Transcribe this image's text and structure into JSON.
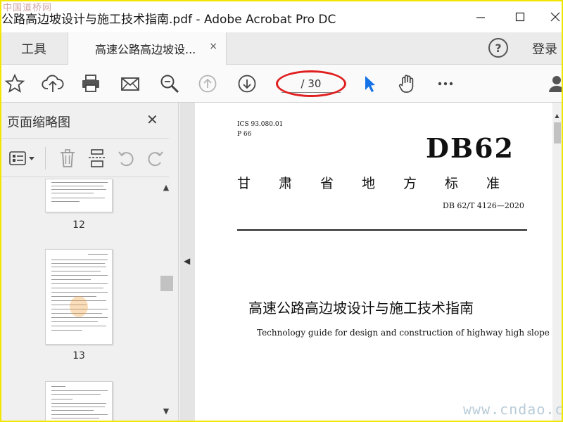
{
  "window": {
    "title": "公路高边坡设计与施工技术指南.pdf - Adobe Acrobat Pro DC",
    "minimize_icon": "minimize-icon",
    "maximize_icon": "maximize-icon",
    "close_icon": "close-icon"
  },
  "watermarks": {
    "top": "中国道桥网",
    "bottom": "www.cndao.com"
  },
  "tabs": {
    "tools_label": "工具",
    "document_label": "高速公路高边坡设...",
    "close_glyph": "×",
    "help_glyph": "?",
    "login_label": "登录"
  },
  "toolbar": {
    "icons": [
      "star-icon",
      "cloud-upload-icon",
      "print-icon",
      "mail-icon",
      "zoom-icon",
      "page-up-icon",
      "page-down-icon",
      "select-pointer-icon",
      "hand-tool-icon",
      "more-icon",
      "user-icon"
    ],
    "page_indicator": "/ 30",
    "accent": "#1473e6",
    "highlight_color": "#e02020"
  },
  "sidebar": {
    "title": "页面缩略图",
    "close_glyph": "✕",
    "tool_icons": [
      "options-menu-icon",
      "delete-icon",
      "extract-pages-icon",
      "rotate-ccw-icon",
      "rotate-cw-icon"
    ],
    "thumbnails": [
      {
        "page_label": "12"
      },
      {
        "page_label": "13"
      },
      {
        "page_label": ""
      }
    ]
  },
  "document": {
    "ics": "ICS    93.080.01",
    "p_code": "P    66",
    "db_code": "DB62",
    "province": "甘肃省地方标准",
    "standard_number": "DB 62/T  4126—2020",
    "title_cn": "高速公路高边坡设计与施工技术指南",
    "title_en": "Technology guide for design and construction of highway high slope"
  }
}
